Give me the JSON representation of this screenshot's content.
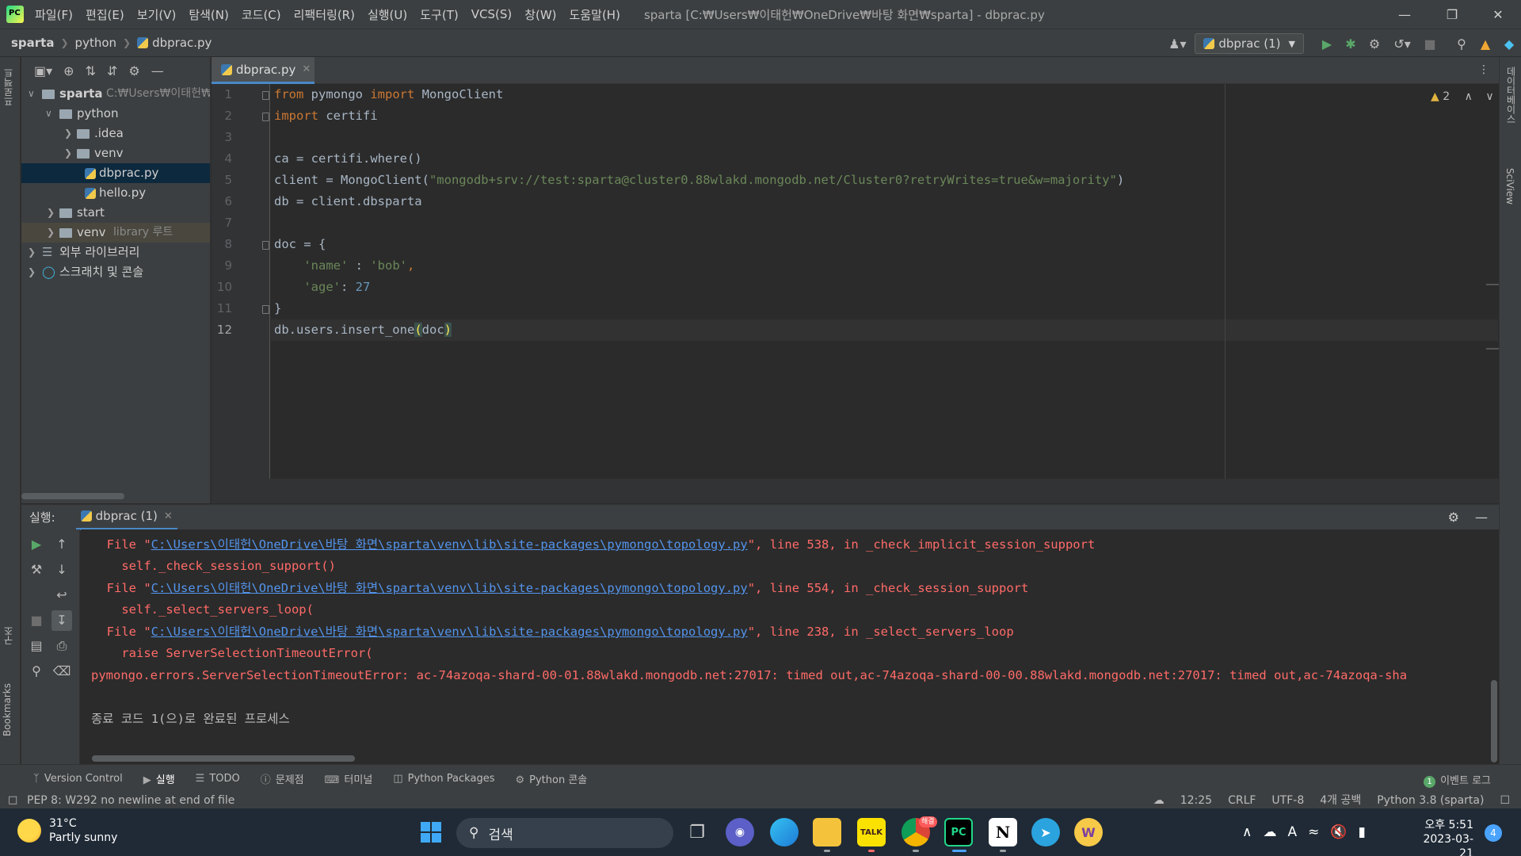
{
  "menu": [
    "파일(F)",
    "편집(E)",
    "보기(V)",
    "탐색(N)",
    "코드(C)",
    "리팩터링(R)",
    "실행(U)",
    "도구(T)",
    "VCS(S)",
    "창(W)",
    "도움말(H)"
  ],
  "window_title": "sparta [C:₩Users₩이태헌₩OneDrive₩바탕 화면₩sparta] - dbprac.py",
  "breadcrumb": {
    "project": "sparta",
    "folder": "python",
    "file": "dbprac.py"
  },
  "run_config": "dbprac (1)",
  "left_stripe": {
    "project_tab": "프로젝트",
    "structure_tab": "구조",
    "bookmarks_tab": "Bookmarks"
  },
  "right_stripe": {
    "database_tab": "데이터베이스",
    "sciview_tab": "SciView"
  },
  "project_tree": {
    "root_label": "sparta",
    "root_path": "C:₩Users₩이태헌₩O",
    "python": "python",
    "idea": ".idea",
    "venv_inner": "venv",
    "dbprac": "dbprac.py",
    "hello": "hello.py",
    "start": "start",
    "venv": "venv",
    "venv_hint": "library 루트",
    "external_libs": "외부 라이브러리",
    "scratches": "스크래치 및 콘솔"
  },
  "editor": {
    "tab_label": "dbprac.py",
    "inspection_count": "2",
    "line_numbers": [
      "1",
      "2",
      "3",
      "4",
      "5",
      "6",
      "7",
      "8",
      "9",
      "10",
      "11",
      "12"
    ],
    "code": {
      "l1_from": "from",
      "l1_mod": " pymongo ",
      "l1_import": "import",
      "l1_name": " MongoClient",
      "l2_import": "import",
      "l2_mod": " certifi",
      "l4": "ca = certifi.where()",
      "l5_pre": "client = MongoClient(",
      "l5_str": "\"mongodb+srv://test:sparta@cluster0.88wlakd.mongodb.net/Cluster0?retryWrites=true&w=majority\"",
      "l5_post": ")",
      "l6": "db = client.dbsparta",
      "l8": "doc = {",
      "l9_key": "    'name'",
      "l9_sep": " : ",
      "l9_val": "'bob'",
      "l9_end": ",",
      "l10_key": "    'age'",
      "l10_sep": ": ",
      "l10_val": "27",
      "l11": "}",
      "l12_pre": "db.users.insert_one",
      "l12_open": "(",
      "l12_arg": "doc",
      "l12_close": ")"
    }
  },
  "run_panel": {
    "label": "실행:",
    "tab": "dbprac (1)",
    "console": {
      "file_prefix": "  File \"",
      "path": "C:\\Users\\이태헌\\OneDrive\\바탕 화면\\sparta\\venv\\lib\\site-packages\\pymongo\\topology.py",
      "line1_suffix": "\", line 538, in _check_implicit_session_support",
      "line2": "    self._check_session_support()",
      "line3_suffix": "\", line 554, in _check_session_support",
      "line4": "    self._select_servers_loop(",
      "line5_suffix": "\", line 238, in _select_servers_loop",
      "line6": "    raise ServerSelectionTimeoutError(",
      "line7": "pymongo.errors.ServerSelectionTimeoutError: ac-74azoqa-shard-00-01.88wlakd.mongodb.net:27017: timed out,ac-74azoqa-shard-00-00.88wlakd.mongodb.net:27017: timed out,ac-74azoqa-sha",
      "exit_message": "종료 코드 1(으)로 완료된 프로세스"
    }
  },
  "bottom_tools": {
    "version_control": "Version Control",
    "run": "실행",
    "todo": "TODO",
    "problems": "문제점",
    "terminal": "터미널",
    "python_packages": "Python Packages",
    "python_console": "Python 콘솔",
    "event_log": "이벤트 로그",
    "event_count": "1"
  },
  "status_bar": {
    "message": "PEP 8: W292 no newline at end of file",
    "position": "12:25",
    "line_sep": "CRLF",
    "encoding": "UTF-8",
    "indent": "4개 공백",
    "interpreter": "Python 3.8 (sparta)"
  },
  "taskbar": {
    "temperature": "31°C",
    "weather": "Partly sunny",
    "search_placeholder": "검색",
    "time": "오후 5:51",
    "date": "2023-03-21",
    "notification_count": "4",
    "kakao_label": "TALK",
    "chrome_badge": "해결"
  }
}
